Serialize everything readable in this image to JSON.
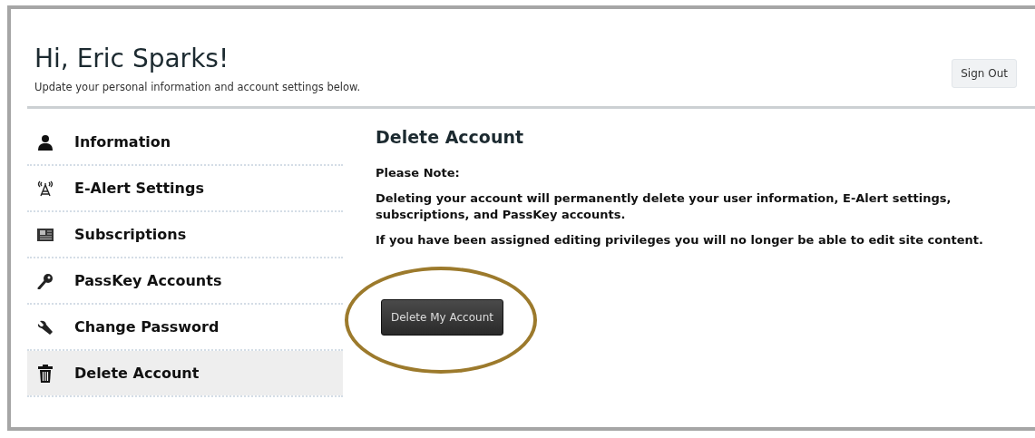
{
  "header": {
    "greeting": "Hi, Eric Sparks!",
    "subtitle": "Update your personal information and account settings below.",
    "sign_out": "Sign Out"
  },
  "sidebar": {
    "items": [
      {
        "label": "Information",
        "selected": false
      },
      {
        "label": "E-Alert Settings",
        "selected": false
      },
      {
        "label": "Subscriptions",
        "selected": false
      },
      {
        "label": "PassKey Accounts",
        "selected": false
      },
      {
        "label": "Change Password",
        "selected": false
      },
      {
        "label": "Delete Account",
        "selected": true
      }
    ]
  },
  "content": {
    "title": "Delete Account",
    "paragraphs": [
      "Please Note:",
      "Deleting your account will permanently delete your user information, E-Alert settings, subscriptions, and PassKey accounts.",
      "If you have been assigned editing privileges you will no longer be able to edit site content."
    ],
    "button": "Delete My Account",
    "callout": {
      "kind": "ellipse"
    }
  }
}
